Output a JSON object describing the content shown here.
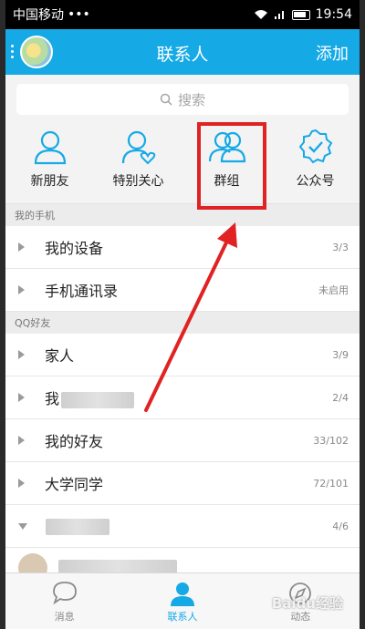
{
  "status_bar": {
    "carrier": "中国移动",
    "signal_dots": "•••",
    "time": "19:54"
  },
  "header": {
    "title": "联系人",
    "add_label": "添加"
  },
  "search": {
    "placeholder": "搜索"
  },
  "quick_actions": [
    {
      "label": "新朋友",
      "icon": "new-friend-icon"
    },
    {
      "label": "特别关心",
      "icon": "special-care-icon"
    },
    {
      "label": "群组",
      "icon": "group-icon"
    },
    {
      "label": "公众号",
      "icon": "official-account-icon"
    }
  ],
  "sections": [
    {
      "title": "我的手机",
      "groups": [
        {
          "name": "我的设备",
          "count": "3/3"
        },
        {
          "name": "手机通讯录",
          "count": "未启用"
        }
      ]
    },
    {
      "title": "QQ好友",
      "groups": [
        {
          "name": "家人",
          "count": "3/9"
        },
        {
          "name": "我",
          "count": "2/4"
        },
        {
          "name": "我的好友",
          "count": "33/102"
        },
        {
          "name": "大学同学",
          "count": "72/101"
        },
        {
          "name": "",
          "count": "4/6"
        }
      ]
    }
  ],
  "tabs": [
    {
      "label": "消息",
      "icon": "message-icon"
    },
    {
      "label": "联系人",
      "icon": "contacts-icon"
    },
    {
      "label": "动态",
      "icon": "feed-icon"
    }
  ],
  "colors": {
    "brand": "#15a9e6",
    "highlight": "#e02222"
  },
  "watermark": "Baidu经验"
}
